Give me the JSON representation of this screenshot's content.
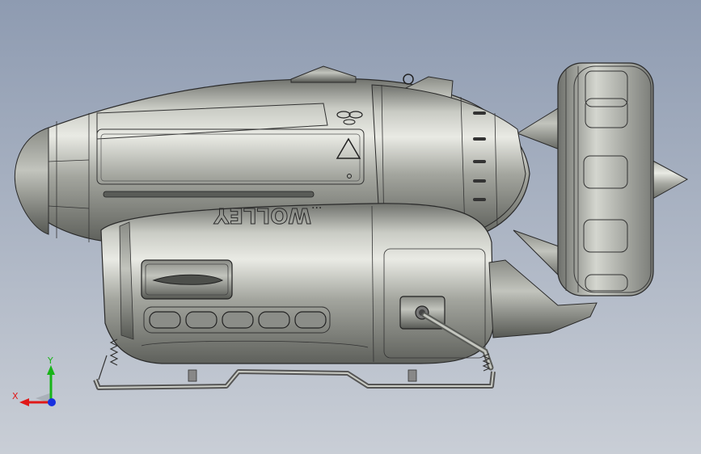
{
  "viewport": {
    "colors": {
      "bg_top": "#8e9bb1",
      "bg_bottom": "#c9ced6"
    }
  },
  "model": {
    "hull_markings": [
      "WOLLEY",
      "···"
    ],
    "vent_slots": 5,
    "icons": [
      "warning-triangle-icon"
    ]
  },
  "triad": {
    "x_label": "X",
    "y_label": "Y",
    "colors": {
      "x": "#e01818",
      "y": "#18b418",
      "z": "#1830e0"
    }
  }
}
